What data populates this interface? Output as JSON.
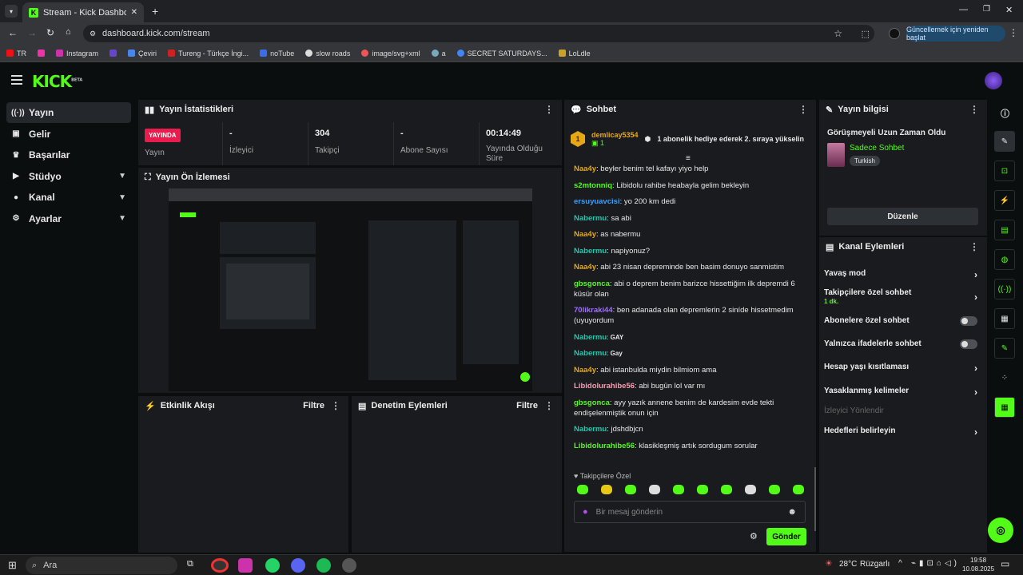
{
  "browser": {
    "tab_title": "Stream - Kick Dashboard",
    "url": "dashboard.kick.com/stream",
    "update_button": "Güncellemek için yeniden başlat",
    "bookmarks": [
      "TR",
      "Instagram",
      "Çeviri",
      "Tureng - Türkçe İngi...",
      "noTube",
      "slow roads",
      "image/svg+xml",
      "a",
      "SECRET SATURDAYS...",
      "LoLdle"
    ]
  },
  "app": {
    "logo": "KICK",
    "logo_sup": "BETA",
    "nav": [
      {
        "label": "Yayın"
      },
      {
        "label": "Gelir"
      },
      {
        "label": "Başarılar"
      },
      {
        "label": "Stüdyo"
      },
      {
        "label": "Kanal"
      },
      {
        "label": "Ayarlar"
      }
    ]
  },
  "stats": {
    "title": "Yayın İstatistikleri",
    "live_badge": "YAYINDA",
    "cells": [
      {
        "value": "",
        "label": "Yayın"
      },
      {
        "value": "-",
        "label": "İzleyici"
      },
      {
        "value": "304",
        "label": "Takipçi"
      },
      {
        "value": "-",
        "label": "Abone Sayısı"
      },
      {
        "value": "00:14:49",
        "label": "Yayında Olduğu Süre"
      }
    ]
  },
  "preview": {
    "title": "Yayın Ön İzlemesi"
  },
  "activity": {
    "title": "Etkinlik Akışı",
    "filter": "Filtre"
  },
  "moderation": {
    "title": "Denetim Eylemleri",
    "filter": "Filtre"
  },
  "chat": {
    "title": "Sohbet",
    "pinned_user": "demlicay5354",
    "pinned_count": "1",
    "pinned_rank": "1",
    "pinned_text": "1 abonelik hediye ederek 2. sıraya yükselin",
    "messages": [
      {
        "user": "Naa4y",
        "color": "#e6a817",
        "text": "beyler benim tel kafayı yiyo help"
      },
      {
        "user": "s2mtonniq",
        "color": "#53fc18",
        "text": "Libidolu rahibe heabayla gelim bekleyin"
      },
      {
        "user": "ersuyuavcisi",
        "color": "#3aa0ff",
        "text": "yo 200 km dedi"
      },
      {
        "user": "Nabermu",
        "color": "#20c9b0",
        "text": "sa abi"
      },
      {
        "user": "Naa4y",
        "color": "#e6a817",
        "text": "as nabermu"
      },
      {
        "user": "Nabermu",
        "color": "#20c9b0",
        "text": "napiyonuz?"
      },
      {
        "user": "Naa4y",
        "color": "#e6a817",
        "text": "abi 23 nisan depreminde ben basim donuyo sanmistim"
      },
      {
        "user": "gbsgonca",
        "color": "#53fc18",
        "text": "abi o deprem benim barizce hissettiğim ilk depremdi 6 küsür olan"
      },
      {
        "user": "70likraki44",
        "color": "#a070ff",
        "text": "ben adanada olan depremlerin 2 siníde hissetmedim (uyuyordum"
      },
      {
        "user": "Nabermu",
        "color": "#20c9b0",
        "text": "GAY"
      },
      {
        "user": "Nabermu",
        "color": "#20c9b0",
        "text": "Gay"
      },
      {
        "user": "Naa4y",
        "color": "#e6a817",
        "text": "abi istanbulda miydin bilmiom ama"
      },
      {
        "user": "Libidolurahibe56",
        "color": "#ff9ab0",
        "text": "abi bugün lol var mı"
      },
      {
        "user": "gbsgonca",
        "color": "#53fc18",
        "text": "ayy yazık annene benim de kardesim evde tekti endişelenmiştik onun için"
      },
      {
        "user": "Nabermu",
        "color": "#20c9b0",
        "text": "jdshdbjcn"
      },
      {
        "user": "Libidolurahibe56",
        "color": "#53fc18",
        "text": "klasikleşmiş artık sordugum sorular"
      }
    ],
    "emote_section": "Takipçilere Özel",
    "input_placeholder": "Bir mesaj gönderin",
    "send_label": "Gönder"
  },
  "info": {
    "title": "Yayın bilgisi",
    "stream_title": "Görüşmeyeli Uzun Zaman Oldu",
    "category": "Sadece Sohbet",
    "language": "Turkish",
    "edit_label": "Düzenle"
  },
  "channel": {
    "title": "Kanal Eylemleri",
    "rows": [
      {
        "label": "Yavaş mod",
        "kind": "arrow"
      },
      {
        "label": "Takipçilere özel sohbet",
        "sub": "1 dk.",
        "kind": "arrow"
      },
      {
        "label": "Abonelere özel sohbet",
        "kind": "toggle"
      },
      {
        "label": "Yalnızca ifadelerle sohbet",
        "kind": "toggle"
      },
      {
        "label": "Hesap yaşı kısıtlaması",
        "kind": "arrow"
      },
      {
        "label": "Yasaklanmış kelimeler",
        "kind": "arrow"
      },
      {
        "label": "İzleyici Yönlendir",
        "kind": "disabled"
      },
      {
        "label": "Hedefleri belirleyin",
        "kind": "arrow"
      }
    ]
  },
  "taskbar": {
    "search": "Ara",
    "weather": "28°C",
    "weather_desc": "Rüzgarlı",
    "time": "19:58",
    "date": "10.08.2025"
  }
}
